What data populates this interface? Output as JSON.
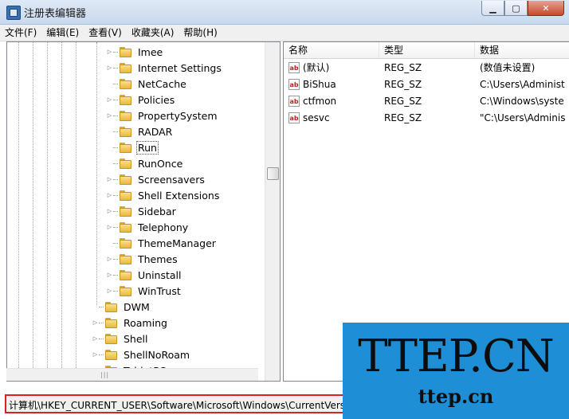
{
  "window": {
    "title": "注册表编辑器",
    "min_glyph": "▁",
    "max_glyph": "▢",
    "close_glyph": "✕"
  },
  "menu": [
    "文件(F)",
    "编辑(E)",
    "查看(V)",
    "收藏夹(A)",
    "帮助(H)"
  ],
  "tree": [
    {
      "label": "Imee",
      "expander": "▷",
      "selected": false
    },
    {
      "label": "Internet Settings",
      "expander": "▷",
      "selected": false
    },
    {
      "label": "NetCache",
      "expander": "",
      "selected": false
    },
    {
      "label": "Policies",
      "expander": "▷",
      "selected": false
    },
    {
      "label": "PropertySystem",
      "expander": "▷",
      "selected": false
    },
    {
      "label": "RADAR",
      "expander": "",
      "selected": false
    },
    {
      "label": "Run",
      "expander": "",
      "selected": true
    },
    {
      "label": "RunOnce",
      "expander": "",
      "selected": false
    },
    {
      "label": "Screensavers",
      "expander": "▷",
      "selected": false
    },
    {
      "label": "Shell Extensions",
      "expander": "▷",
      "selected": false
    },
    {
      "label": "Sidebar",
      "expander": "▷",
      "selected": false
    },
    {
      "label": "Telephony",
      "expander": "▷",
      "selected": false
    },
    {
      "label": "ThemeManager",
      "expander": "",
      "selected": false
    },
    {
      "label": "Themes",
      "expander": "▷",
      "selected": false
    },
    {
      "label": "Uninstall",
      "expander": "▷",
      "selected": false
    },
    {
      "label": "WinTrust",
      "expander": "▷",
      "selected": false
    },
    {
      "label": "DWM",
      "expander": "",
      "selected": false
    },
    {
      "label": "Roaming",
      "expander": "▷",
      "selected": false
    },
    {
      "label": "Shell",
      "expander": "▷",
      "selected": false
    },
    {
      "label": "ShellNoRoam",
      "expander": "▷",
      "selected": false
    },
    {
      "label": "TabletPC",
      "expander": "▷",
      "selected": false
    }
  ],
  "list": {
    "columns": [
      "名称",
      "类型",
      "数据"
    ],
    "rows": [
      {
        "name": "(默认)",
        "type": "REG_SZ",
        "data": "(数值未设置)"
      },
      {
        "name": "BiShua",
        "type": "REG_SZ",
        "data": "C:\\Users\\Administ"
      },
      {
        "name": "ctfmon",
        "type": "REG_SZ",
        "data": "C:\\Windows\\syste"
      },
      {
        "name": "sesvc",
        "type": "REG_SZ",
        "data": "\"C:\\Users\\Adminis"
      }
    ],
    "value_icon_text": "ab"
  },
  "status": {
    "path": "计算机\\HKEY_CURRENT_USER\\Software\\Microsoft\\Windows\\CurrentVersion\\Run"
  },
  "scroll": {
    "h_grip": "|||"
  },
  "watermark": {
    "big": "TTEP.CN",
    "small": "ttep.cn",
    "color": "#1e8fd6"
  }
}
